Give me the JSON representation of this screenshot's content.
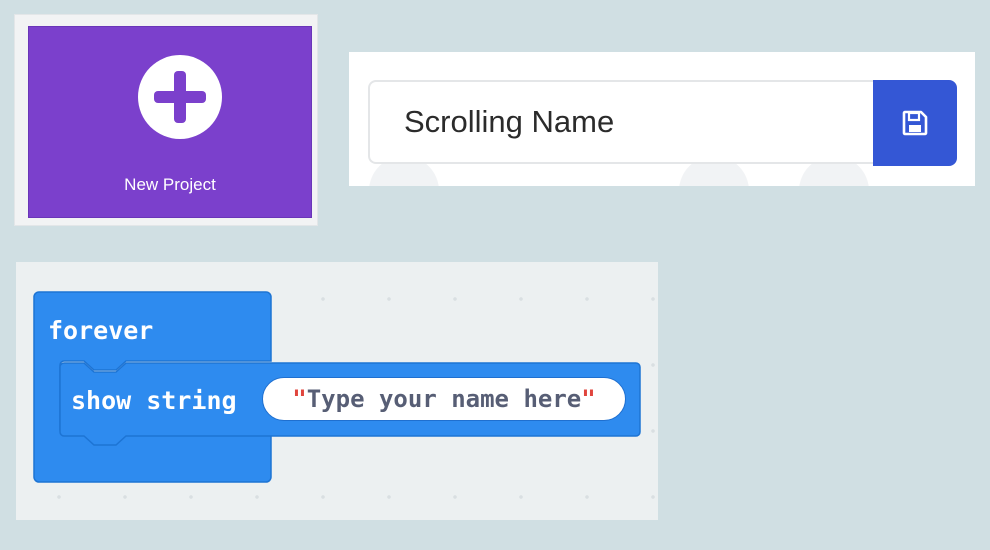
{
  "new_project": {
    "label": "New Project",
    "icon": "plus-icon",
    "color": "#7b40cc"
  },
  "project_name": {
    "value": "Scrolling Name",
    "save_icon": "save-icon",
    "save_color": "#3457d5"
  },
  "blocks": {
    "forever_label": "forever",
    "show_string_label": "show string",
    "string_value": "Type your name here",
    "quote_open": "\"",
    "quote_close": "\"",
    "block_color": "#2e8bef"
  }
}
